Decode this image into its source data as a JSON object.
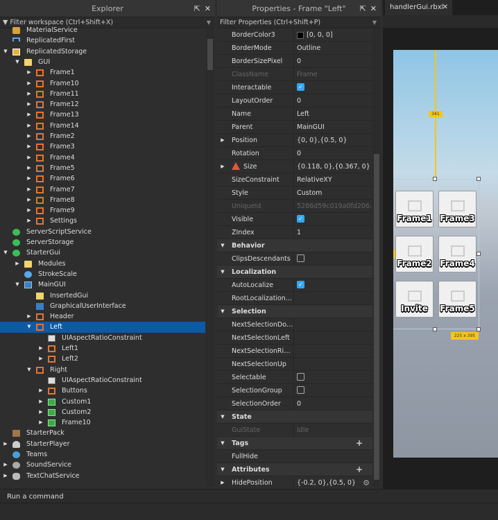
{
  "explorer": {
    "title": "Explorer",
    "filter_placeholder": "Filter workspace (Ctrl+Shift+X)",
    "items": [
      {
        "label": "MaterialService",
        "level": 0,
        "icon": "service",
        "arrow": ""
      },
      {
        "label": "ReplicatedFirst",
        "level": 0,
        "icon": "replfirst",
        "arrow": ""
      },
      {
        "label": "ReplicatedStorage",
        "level": 0,
        "icon": "storage",
        "arrow": "open"
      },
      {
        "label": "GUI",
        "level": 1,
        "icon": "folder",
        "arrow": "open"
      },
      {
        "label": "Frame1",
        "level": 2,
        "icon": "frame",
        "arrow": "closed"
      },
      {
        "label": "Frame10",
        "level": 2,
        "icon": "frame",
        "arrow": "closed"
      },
      {
        "label": "Frame11",
        "level": 2,
        "icon": "frame",
        "arrow": "closed"
      },
      {
        "label": "Frame12",
        "level": 2,
        "icon": "frame",
        "arrow": "closed"
      },
      {
        "label": "Frame13",
        "level": 2,
        "icon": "frame",
        "arrow": "closed"
      },
      {
        "label": "Frame14",
        "level": 2,
        "icon": "frame",
        "arrow": "closed"
      },
      {
        "label": "Frame2",
        "level": 2,
        "icon": "frame",
        "arrow": "closed"
      },
      {
        "label": "Frame3",
        "level": 2,
        "icon": "frame",
        "arrow": "closed"
      },
      {
        "label": "Frame4",
        "level": 2,
        "icon": "frame",
        "arrow": "closed"
      },
      {
        "label": "Frame5",
        "level": 2,
        "icon": "frame",
        "arrow": "closed"
      },
      {
        "label": "Frame6",
        "level": 2,
        "icon": "frame",
        "arrow": "closed"
      },
      {
        "label": "Frame7",
        "level": 2,
        "icon": "frame",
        "arrow": "closed"
      },
      {
        "label": "Frame8",
        "level": 2,
        "icon": "frame",
        "arrow": "closed"
      },
      {
        "label": "Frame9",
        "level": 2,
        "icon": "frame",
        "arrow": "closed"
      },
      {
        "label": "Settings",
        "level": 2,
        "icon": "frame",
        "arrow": "closed"
      },
      {
        "label": "ServerScriptService",
        "level": 0,
        "icon": "server",
        "arrow": ""
      },
      {
        "label": "ServerStorage",
        "level": 0,
        "icon": "server",
        "arrow": ""
      },
      {
        "label": "StarterGui",
        "level": 0,
        "icon": "server",
        "arrow": "open"
      },
      {
        "label": "Modules",
        "level": 1,
        "icon": "folder",
        "arrow": "closed"
      },
      {
        "label": "StrokeScale",
        "level": 1,
        "icon": "scale",
        "arrow": ""
      },
      {
        "label": "MainGUI",
        "level": 1,
        "icon": "gui",
        "arrow": "open"
      },
      {
        "label": "InsertedGui",
        "level": 2,
        "icon": "insgui",
        "arrow": ""
      },
      {
        "label": "GraphicalUserInterface",
        "level": 2,
        "icon": "graphical",
        "arrow": ""
      },
      {
        "label": "Header",
        "level": 2,
        "icon": "frame",
        "arrow": "closed"
      },
      {
        "label": "Left",
        "level": 2,
        "icon": "frame",
        "arrow": "open",
        "selected": true
      },
      {
        "label": "UIAspectRatioConstraint",
        "level": 3,
        "icon": "constraint",
        "arrow": ""
      },
      {
        "label": "Left1",
        "level": 3,
        "icon": "frame",
        "arrow": "closed"
      },
      {
        "label": "Left2",
        "level": 3,
        "icon": "frame",
        "arrow": "closed"
      },
      {
        "label": "Right",
        "level": 2,
        "icon": "frame",
        "arrow": "open"
      },
      {
        "label": "UIAspectRatioConstraint",
        "level": 3,
        "icon": "constraint",
        "arrow": ""
      },
      {
        "label": "Buttons",
        "level": 3,
        "icon": "frame",
        "arrow": "closed"
      },
      {
        "label": "Custom1",
        "level": 3,
        "icon": "image",
        "arrow": "closed"
      },
      {
        "label": "Custom2",
        "level": 3,
        "icon": "image",
        "arrow": "closed"
      },
      {
        "label": "Frame10",
        "level": 3,
        "icon": "image",
        "arrow": "closed"
      },
      {
        "label": "StarterPack",
        "level": 0,
        "icon": "pack",
        "arrow": ""
      },
      {
        "label": "StarterPlayer",
        "level": 0,
        "icon": "player",
        "arrow": "closed"
      },
      {
        "label": "Teams",
        "level": 0,
        "icon": "teams",
        "arrow": ""
      },
      {
        "label": "SoundService",
        "level": 0,
        "icon": "sound",
        "arrow": "closed"
      },
      {
        "label": "TextChatService",
        "level": 0,
        "icon": "text",
        "arrow": "closed"
      }
    ]
  },
  "properties": {
    "title": "Properties - Frame \"Left\"",
    "filter_placeholder": "Filter Properties (Ctrl+Shift+P)",
    "rows": [
      {
        "name": "BorderColor3",
        "value": "[0, 0, 0]",
        "type": "color"
      },
      {
        "name": "BorderMode",
        "value": "Outline"
      },
      {
        "name": "BorderSizePixel",
        "value": "0"
      },
      {
        "name": "ClassName",
        "value": "Frame",
        "dim": true
      },
      {
        "name": "Interactable",
        "type": "check",
        "checked": true
      },
      {
        "name": "LayoutOrder",
        "value": "0"
      },
      {
        "name": "Name",
        "value": "Left"
      },
      {
        "name": "Parent",
        "value": "MainGUI"
      },
      {
        "name": "Position",
        "value": "{0, 0},{0.5, 0}",
        "expand": true
      },
      {
        "name": "Rotation",
        "value": "0"
      },
      {
        "name": "Size",
        "value": "{0.118, 0},{0.367, 0}",
        "expand": true,
        "warning": true
      },
      {
        "name": "SizeConstraint",
        "value": "RelativeXY"
      },
      {
        "name": "Style",
        "value": "Custom"
      },
      {
        "name": "UniqueId",
        "value": "5286d59c019a0fd206...",
        "dim": true
      },
      {
        "name": "Visible",
        "type": "check",
        "checked": true
      },
      {
        "name": "ZIndex",
        "value": "1"
      },
      {
        "name": "Behavior",
        "type": "header"
      },
      {
        "name": "ClipsDescendants",
        "type": "check",
        "checked": false
      },
      {
        "name": "Localization",
        "type": "header"
      },
      {
        "name": "AutoLocalize",
        "type": "check",
        "checked": true
      },
      {
        "name": "RootLocalization...",
        "value": ""
      },
      {
        "name": "Selection",
        "type": "header"
      },
      {
        "name": "NextSelectionDown",
        "value": ""
      },
      {
        "name": "NextSelectionLeft",
        "value": ""
      },
      {
        "name": "NextSelectionRight",
        "value": ""
      },
      {
        "name": "NextSelectionUp",
        "value": ""
      },
      {
        "name": "Selectable",
        "type": "check",
        "checked": false
      },
      {
        "name": "SelectionGroup",
        "type": "check",
        "checked": false
      },
      {
        "name": "SelectionOrder",
        "value": "0"
      },
      {
        "name": "State",
        "type": "header"
      },
      {
        "name": "GuiState",
        "value": "Idle",
        "dim": true
      },
      {
        "name": "Tags",
        "type": "header",
        "plus": true
      },
      {
        "name": "FullHide",
        "type": "tag"
      },
      {
        "name": "Attributes",
        "type": "header",
        "plus": true
      },
      {
        "name": "HidePosition",
        "value": "{-0.2, 0},{0.5, 0}",
        "expand": true,
        "gear": true
      }
    ]
  },
  "viewport": {
    "tab_label": "handlerGui.rbxl",
    "height_label": "341",
    "size_label": "225 x 395",
    "tiles": [
      "Frame1",
      "Frame3",
      "Frame2",
      "Frame4",
      "Invite",
      "Frame5"
    ]
  },
  "command_bar": {
    "placeholder": "Run a command"
  },
  "colors": {
    "selection": "#0b5aa8",
    "accent": "#35a7f0",
    "guide": "#f5c518"
  }
}
